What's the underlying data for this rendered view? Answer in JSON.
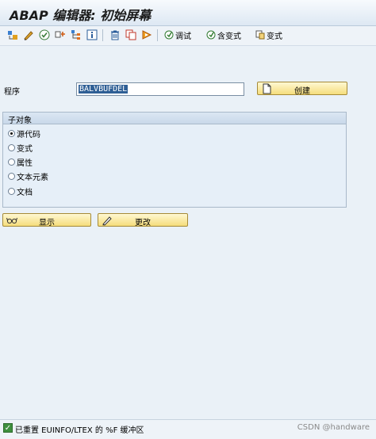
{
  "window": {
    "title": "ABAP 编辑器: 初始屏幕"
  },
  "toolbar": {
    "icons": [
      "other-object-icon",
      "edit-pencil-icon",
      "check-icon",
      "test-icon",
      "where-used-icon",
      "info-icon",
      "delete-icon",
      "copy-icon",
      "activate-icon"
    ],
    "debug_label": "调试",
    "with_variant_label": "含变式",
    "variant_label": "变式"
  },
  "form": {
    "program_label": "程序",
    "program_value": "BALVBUFDEL",
    "create_label": "创建"
  },
  "subobjects": {
    "title": "子对象",
    "options": [
      {
        "label": "源代码",
        "selected": true
      },
      {
        "label": "变式",
        "selected": false
      },
      {
        "label": "属性",
        "selected": false
      },
      {
        "label": "文本元素",
        "selected": false
      },
      {
        "label": "文档",
        "selected": false
      }
    ]
  },
  "actions": {
    "display_label": "显示",
    "change_label": "更改"
  },
  "status": {
    "message": "已重置 EUINFO/LTEX 的 %F 缓冲区",
    "watermark": "CSDN @handware"
  }
}
